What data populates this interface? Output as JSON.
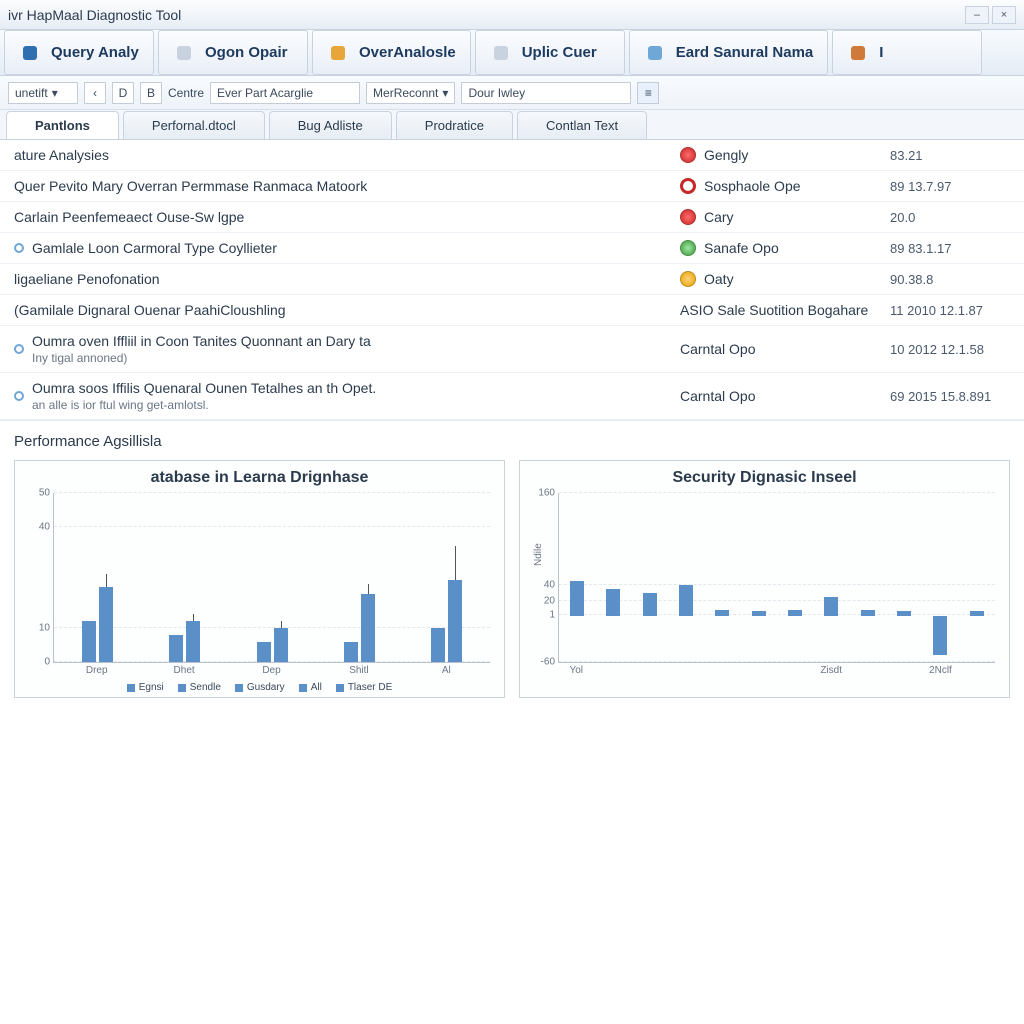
{
  "window": {
    "title": "ivr HapMaal Diagnostic Tool"
  },
  "ribbon": [
    {
      "label": "Query Analy",
      "icon": "query-icon",
      "color": "#2f6fb0"
    },
    {
      "label": "Ogon Opair",
      "icon": "cylinder-icon",
      "color": "#c9d3df"
    },
    {
      "label": "OverAnalosle",
      "icon": "person-icon",
      "color": "#e7a53a"
    },
    {
      "label": "Uplic Cuer",
      "icon": "doc-icon",
      "color": "#c9d3df"
    },
    {
      "label": "Eard Sanural Nama",
      "icon": "gear-icon",
      "color": "#6fa7d6"
    },
    {
      "label": "I",
      "icon": "misc-icon",
      "color": "#d07a3a"
    }
  ],
  "toolbar": {
    "select1": "unetift",
    "btn_d": "D",
    "btn_b": "B",
    "label_centre": "Centre",
    "input1": "Ever Part Acarglie",
    "select2": "MerReconnt",
    "input2": "Dour Iwley"
  },
  "tabs": [
    {
      "label": "Pantlons",
      "active": true
    },
    {
      "label": "Perfornal.dtocl",
      "active": false
    },
    {
      "label": "Bug Adliste",
      "active": false
    },
    {
      "label": "Prodratice",
      "active": false
    },
    {
      "label": "Contlan Text",
      "active": false
    }
  ],
  "rows": [
    {
      "label": "ature Analysies",
      "sub": "",
      "statusColor": "red",
      "status": "Gengly",
      "value": "83.21",
      "bullet": false
    },
    {
      "label": "Quer Pevito Mary Overran Permmase Ranmaca Matoork",
      "sub": "",
      "statusColor": "ring",
      "status": "Sosphaole Ope",
      "value": "89 13.7.97",
      "bullet": false
    },
    {
      "label": "Carlain Peenfemeaect Ouse-Sw lgpe",
      "sub": "",
      "statusColor": "red",
      "status": "Cary",
      "value": "20.0",
      "bullet": false
    },
    {
      "label": "Gamlale Loon Carmoral Type Coyllieter",
      "sub": "",
      "statusColor": "green",
      "status": "Sanafe Opo",
      "value": "89 83.1.17",
      "bullet": true
    },
    {
      "label": "ligaeliane Penofonation",
      "sub": "",
      "statusColor": "orange",
      "status": "Oaty",
      "value": "90.38.8",
      "bullet": false
    },
    {
      "label": "(Gamilale Dignaral Ouenar PaahiCloushling",
      "sub": "",
      "statusColor": "",
      "status": "ASIO Sale Suotition Bogahare",
      "value": "11 2010 12.1.87",
      "bullet": false
    },
    {
      "label": "Oumra oven Iffliil in Coon Tanites Quonnant an Dary ta",
      "sub": "Iny tigal annoned)",
      "statusColor": "",
      "status": "Carntal Opo",
      "value": "10 2012 12.1.58",
      "bullet": true
    },
    {
      "label": "Oumra soos Iffilis Quenaral Ounen Tetalhes an th Opet.",
      "sub": "an alle is ior ftul wing get-amlotsl.",
      "statusColor": "",
      "status": "Carntal Opo",
      "value": "69 2015 15.8.891",
      "bullet": true
    }
  ],
  "section_title": "Performance Agsillisla",
  "chart_data": [
    {
      "type": "bar",
      "title": "atabase in Learna Drignhase",
      "ylim": [
        0,
        50
      ],
      "yticks": [
        0,
        10,
        40,
        50
      ],
      "categories": [
        "Drep",
        "Dhet",
        "Dep",
        "Shitl",
        "Al"
      ],
      "series": [
        {
          "name": "Egnsi",
          "values": [
            12,
            8,
            6,
            6,
            10
          ]
        },
        {
          "name": "Sendle",
          "values": [
            22,
            12,
            10,
            20,
            24
          ],
          "err": [
            4,
            2,
            2,
            3,
            10
          ]
        }
      ],
      "legend": [
        "Egnsi",
        "Sendle",
        "Gusdary",
        "All",
        "Tlaser DE"
      ]
    },
    {
      "type": "bar",
      "title": "Security Dignasic Inseel",
      "ylim": [
        -60,
        160
      ],
      "yticks": [
        -60,
        1,
        20,
        40,
        160
      ],
      "ylabel": "Ndile",
      "categories": [
        "Yol",
        "",
        "",
        "",
        "",
        "",
        "",
        "Zisdt",
        "",
        "",
        "2Nclf",
        ""
      ],
      "values": [
        45,
        35,
        30,
        40,
        8,
        6,
        8,
        25,
        8,
        6,
        -50,
        6
      ]
    }
  ]
}
